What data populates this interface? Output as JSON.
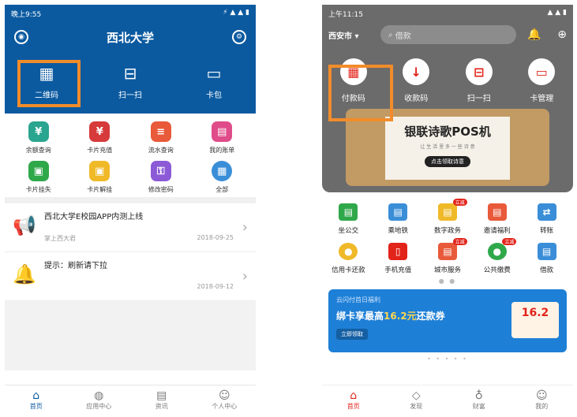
{
  "left": {
    "status_time": "晚上9:55",
    "status_icons": "⚡ ▲ ▲ ▮",
    "title": "西北大学",
    "quick": [
      {
        "icon": "qrcode-icon",
        "glyph": "▦",
        "label": "二维码"
      },
      {
        "icon": "scan-icon",
        "glyph": "⊟",
        "label": "扫一扫"
      },
      {
        "icon": "card-wallet-icon",
        "glyph": "▭",
        "label": "卡包"
      }
    ],
    "grid": [
      {
        "label": "余额查询",
        "color": "#2aa58f",
        "glyph": "¥"
      },
      {
        "label": "卡片充值",
        "color": "#d63a3a",
        "glyph": "¥"
      },
      {
        "label": "流水查询",
        "color": "#e85a3a",
        "glyph": "≡"
      },
      {
        "label": "我的账单",
        "color": "#e04b8a",
        "glyph": "▤"
      },
      {
        "label": "卡片挂失",
        "color": "#2fa84a",
        "glyph": "▣"
      },
      {
        "label": "卡片解挂",
        "color": "#f0b928",
        "glyph": "▣"
      },
      {
        "label": "修改密码",
        "color": "#8c5ad6",
        "glyph": "⚿"
      },
      {
        "label": "全部",
        "color": "#3a8ed8",
        "glyph": "▦"
      }
    ],
    "notices": [
      {
        "title": "西北大学E校园APP内测上线",
        "source": "掌上西大君",
        "date": "2018-09-25"
      },
      {
        "title": "提示：刷新请下拉",
        "source": "",
        "date": "2018-09-12"
      }
    ],
    "tabs": [
      "首页",
      "应用中心",
      "资讯",
      "个人中心"
    ]
  },
  "right": {
    "status_time": "上午11:15",
    "status_icons": "▲ ▲ ▮",
    "city": "西安市 ▾",
    "search_placeholder": "借款",
    "quick": [
      {
        "icon": "payment-code-icon",
        "glyph": "▦",
        "label": "付款码"
      },
      {
        "icon": "receive-code-icon",
        "glyph": "↓",
        "label": "收款码"
      },
      {
        "icon": "scan-icon",
        "glyph": "⊟",
        "label": "扫一扫"
      },
      {
        "icon": "card-manage-icon",
        "glyph": "▭",
        "label": "卡管理"
      }
    ],
    "banner_title": "银联诗歌POS机",
    "banner_subtitle": "让 生 活 里 多 一 些 诗 意",
    "banner_button": "点击领取诗意",
    "grid": [
      {
        "label": "坐公交",
        "color": "#2fa84a",
        "glyph": "▤",
        "badge": ""
      },
      {
        "label": "乘地铁",
        "color": "#3a8ed8",
        "glyph": "▤",
        "badge": ""
      },
      {
        "label": "数字政务",
        "color": "#f0b928",
        "glyph": "▤",
        "badge": "立减"
      },
      {
        "label": "邀请福利",
        "color": "#e85a3a",
        "glyph": "▤",
        "badge": ""
      },
      {
        "label": "转账",
        "color": "#3a8ed8",
        "glyph": "⇄",
        "badge": ""
      },
      {
        "label": "信用卡还款",
        "color": "#f0b928",
        "glyph": "●",
        "badge": ""
      },
      {
        "label": "手机充值",
        "color": "#e2231a",
        "glyph": "▯",
        "badge": ""
      },
      {
        "label": "城市服务",
        "color": "#e85a3a",
        "glyph": "▤",
        "badge": "立减"
      },
      {
        "label": "公共缴费",
        "color": "#2fa84a",
        "glyph": "●",
        "badge": "立减"
      },
      {
        "label": "借款",
        "color": "#3a8ed8",
        "glyph": "▤",
        "badge": ""
      }
    ],
    "promo_line1": "云闪付首日福利",
    "promo_line2_prefix": "绑卡享最高",
    "promo_amount": "16.2元",
    "promo_line2_suffix": "还款券",
    "promo_button": "立即领取",
    "promo_coupon": "16.2",
    "tabs": [
      "首页",
      "发现",
      "财富",
      "我的"
    ]
  }
}
